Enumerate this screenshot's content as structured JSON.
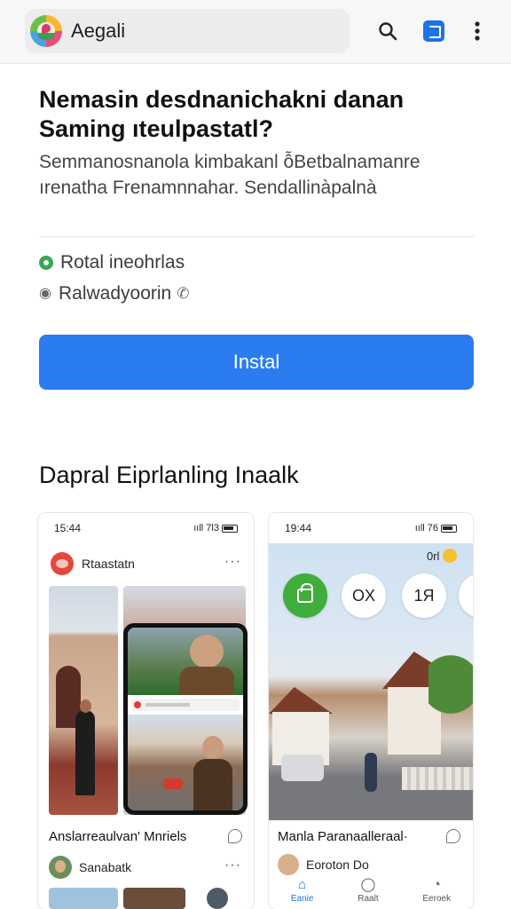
{
  "app": {
    "title": "Aegali"
  },
  "toolbar": {
    "search_icon": "search-icon",
    "share_icon": "share-icon",
    "more_icon": "more-vertical-icon"
  },
  "header": {
    "headline": "Nemasin desdnanichakni danan Saming ıteulpastatl?",
    "description": "Semmanosnanola kimbakanl ỗBetbalnamanre ırenatha Frenamnnahar. Sendallinàpalnà"
  },
  "info": {
    "row1": "Rotal ineohrlas",
    "row2": "Ralwadyoorin"
  },
  "install": {
    "label": "Instal"
  },
  "screenshots": {
    "title": "Dapral Eiprlanling Inaalk",
    "card1": {
      "time": "15:44",
      "signal": "ııll 7l3",
      "profile_name": "Rtaastatn",
      "caption": "Anslarreaulvan' Mnriels",
      "user_name": "Sanabatk"
    },
    "card2": {
      "time": "19:44",
      "signal": "ııll 76",
      "badge": "0rl",
      "circle2": "OX",
      "circle3": "1Я",
      "caption": "Manla Paranaalleraal·",
      "user_name": "Eoroton Do",
      "nav": [
        "Eanie",
        "Raalt",
        "Eeroek"
      ]
    }
  },
  "colors": {
    "accent": "#2b7cf0",
    "green": "#34a853"
  }
}
